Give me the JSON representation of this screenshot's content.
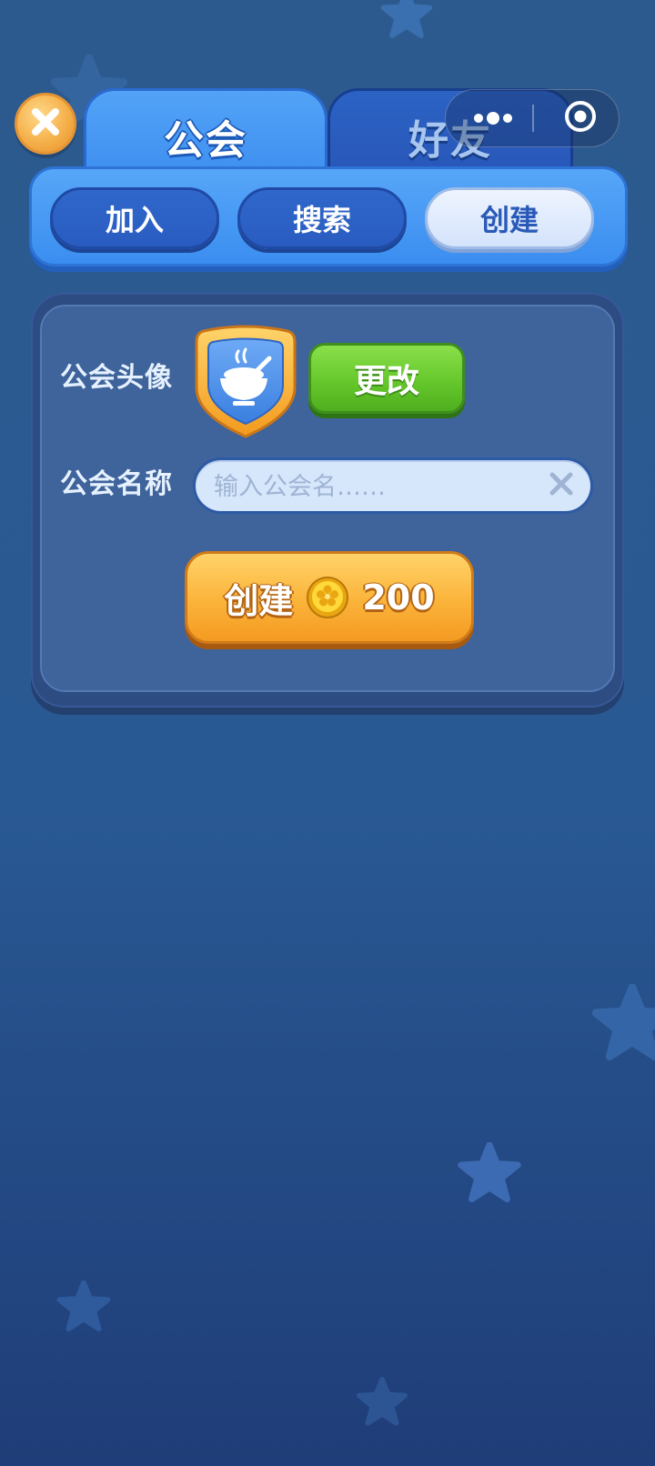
{
  "tabs": [
    {
      "label": "公会",
      "active": true
    },
    {
      "label": "好友",
      "active": false
    }
  ],
  "subtabs": [
    {
      "label": "加入",
      "active": false
    },
    {
      "label": "搜索",
      "active": false
    },
    {
      "label": "创建",
      "active": true
    }
  ],
  "form": {
    "avatar_label": "公会头像",
    "change_button": "更改",
    "name_label": "公会名称",
    "name_value": "",
    "name_placeholder": "输入公会名……",
    "create_button": "创建",
    "create_cost": "200"
  },
  "icons": {
    "close": "close-icon",
    "clear": "clear-icon",
    "coin": "coin-icon",
    "guild_avatar": "rice-bowl-icon",
    "capsule_more": "more-dots-icon",
    "capsule_close": "target-circle-icon"
  },
  "colors": {
    "background": "#295993",
    "active_tab": "#4a9cf5",
    "inactive_tab": "#2a5cbd",
    "panel": "#3f639b",
    "change_button": "#63c52a",
    "create_button": "#fbb33a",
    "close_button": "#f5b04a"
  }
}
